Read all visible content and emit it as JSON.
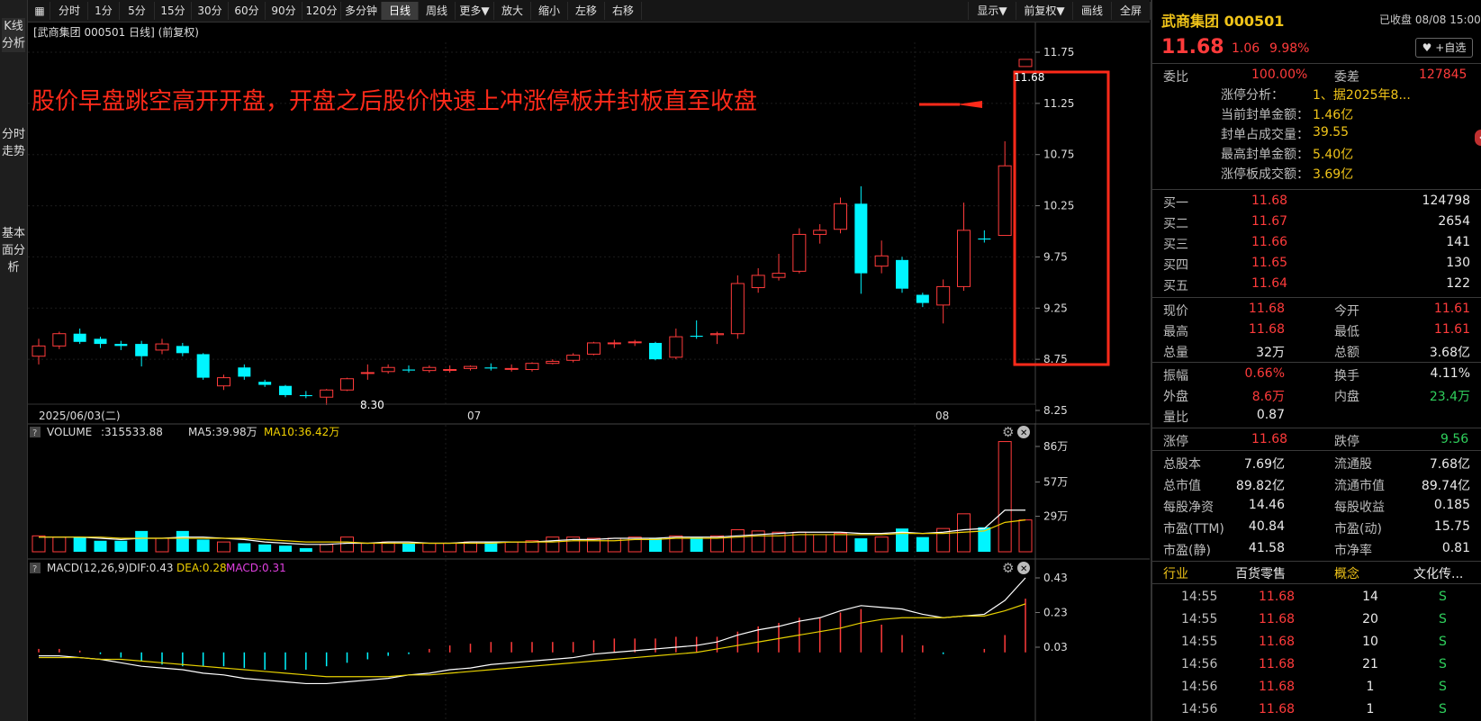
{
  "toolbar": {
    "items": [
      "分时",
      "1分",
      "5分",
      "15分",
      "30分",
      "60分",
      "90分",
      "120分",
      "多分钟",
      "日线",
      "周线",
      "更多▼",
      "放大",
      "缩小",
      "左移",
      "右移"
    ],
    "right_items": [
      "显示▼",
      "前复权▼",
      "画线",
      "全屏"
    ]
  },
  "left_tabs": [
    "K线分析",
    "分时走势",
    "基本面分析"
  ],
  "chart": {
    "header": "[武商集团 000501 日线] (前复权)",
    "annotation": "股价早盘跳空高开开盘，开盘之后股价快速上冲涨停板并封板直至收盘",
    "price_label": "11.68",
    "low_label": "8.30",
    "date_start": "2025/06/03(二)",
    "month_07": "07",
    "month_08": "08",
    "volume_header": ":315533.88",
    "volume_label": "VOLUME",
    "ma5": "MA5:39.98万",
    "ma10": "MA10:36.42万",
    "macd_label": "MACD(12,26,9)",
    "dif": "DIF:0.43",
    "dea": "DEA:0.28",
    "macd": "MACD:0.31"
  },
  "chart_data": {
    "type": "candlestick",
    "price_axis": [
      "11.75",
      "11.25",
      "10.75",
      "10.25",
      "9.75",
      "9.25",
      "8.75",
      "8.25"
    ],
    "volume_axis": [
      "86万",
      "57万",
      "29万"
    ],
    "macd_axis": [
      "0.43",
      "0.23",
      "0.03"
    ],
    "candles": [
      {
        "o": 8.78,
        "c": 8.88,
        "h": 8.95,
        "l": 8.7
      },
      {
        "o": 8.88,
        "c": 9.0,
        "h": 9.02,
        "l": 8.85
      },
      {
        "o": 9.0,
        "c": 8.92,
        "h": 9.05,
        "l": 8.9
      },
      {
        "o": 8.95,
        "c": 8.9,
        "h": 8.97,
        "l": 8.86
      },
      {
        "o": 8.9,
        "c": 8.88,
        "h": 8.93,
        "l": 8.84
      },
      {
        "o": 8.9,
        "c": 8.78,
        "h": 8.93,
        "l": 8.68
      },
      {
        "o": 8.84,
        "c": 8.9,
        "h": 8.95,
        "l": 8.8
      },
      {
        "o": 8.88,
        "c": 8.81,
        "h": 8.91,
        "l": 8.78
      },
      {
        "o": 8.8,
        "c": 8.57,
        "h": 8.81,
        "l": 8.55
      },
      {
        "o": 8.49,
        "c": 8.57,
        "h": 8.6,
        "l": 8.45
      },
      {
        "o": 8.67,
        "c": 8.58,
        "h": 8.7,
        "l": 8.55
      },
      {
        "o": 8.53,
        "c": 8.5,
        "h": 8.55,
        "l": 8.48
      },
      {
        "o": 8.49,
        "c": 8.4,
        "h": 8.5,
        "l": 8.38
      },
      {
        "o": 8.4,
        "c": 8.39,
        "h": 8.44,
        "l": 8.37
      },
      {
        "o": 8.38,
        "c": 8.45,
        "h": 8.46,
        "l": 8.3
      },
      {
        "o": 8.45,
        "c": 8.56,
        "h": 8.57,
        "l": 8.44
      },
      {
        "o": 8.62,
        "c": 8.62,
        "h": 8.7,
        "l": 8.55
      },
      {
        "o": 8.63,
        "c": 8.67,
        "h": 8.7,
        "l": 8.61
      },
      {
        "o": 8.65,
        "c": 8.64,
        "h": 8.69,
        "l": 8.62
      },
      {
        "o": 8.64,
        "c": 8.67,
        "h": 8.69,
        "l": 8.62
      },
      {
        "o": 8.65,
        "c": 8.65,
        "h": 8.69,
        "l": 8.62
      },
      {
        "o": 8.66,
        "c": 8.68,
        "h": 8.69,
        "l": 8.64
      },
      {
        "o": 8.67,
        "c": 8.66,
        "h": 8.71,
        "l": 8.64
      },
      {
        "o": 8.66,
        "c": 8.66,
        "h": 8.7,
        "l": 8.63
      },
      {
        "o": 8.65,
        "c": 8.71,
        "h": 8.72,
        "l": 8.63
      },
      {
        "o": 8.71,
        "c": 8.73,
        "h": 8.75,
        "l": 8.7
      },
      {
        "o": 8.74,
        "c": 8.79,
        "h": 8.81,
        "l": 8.72
      },
      {
        "o": 8.8,
        "c": 8.91,
        "h": 8.92,
        "l": 8.79
      },
      {
        "o": 8.91,
        "c": 8.91,
        "h": 8.94,
        "l": 8.86
      },
      {
        "o": 8.92,
        "c": 8.92,
        "h": 8.94,
        "l": 8.88
      },
      {
        "o": 8.91,
        "c": 8.75,
        "h": 8.92,
        "l": 8.74
      },
      {
        "o": 8.77,
        "c": 8.97,
        "h": 9.05,
        "l": 8.75
      },
      {
        "o": 8.98,
        "c": 8.97,
        "h": 9.13,
        "l": 8.95
      },
      {
        "o": 8.99,
        "c": 9.0,
        "h": 9.02,
        "l": 8.9
      },
      {
        "o": 9.0,
        "c": 9.49,
        "h": 9.57,
        "l": 8.95
      },
      {
        "o": 9.45,
        "c": 9.57,
        "h": 9.64,
        "l": 9.4
      },
      {
        "o": 9.55,
        "c": 9.59,
        "h": 9.78,
        "l": 9.52
      },
      {
        "o": 9.61,
        "c": 9.97,
        "h": 10.03,
        "l": 9.59
      },
      {
        "o": 9.97,
        "c": 10.01,
        "h": 10.07,
        "l": 9.88
      },
      {
        "o": 10.02,
        "c": 10.27,
        "h": 10.33,
        "l": 9.98
      },
      {
        "o": 10.27,
        "c": 9.59,
        "h": 10.44,
        "l": 9.39
      },
      {
        "o": 9.66,
        "c": 9.76,
        "h": 9.91,
        "l": 9.59
      },
      {
        "o": 9.72,
        "c": 9.44,
        "h": 9.75,
        "l": 9.4
      },
      {
        "o": 9.38,
        "c": 9.3,
        "h": 9.4,
        "l": 9.26
      },
      {
        "o": 9.28,
        "c": 9.46,
        "h": 9.53,
        "l": 9.1
      },
      {
        "o": 9.46,
        "c": 10.01,
        "h": 10.28,
        "l": 9.42
      },
      {
        "o": 9.93,
        "c": 9.92,
        "h": 10.01,
        "l": 9.89
      },
      {
        "o": 9.96,
        "c": 10.64,
        "h": 10.88,
        "l": 9.96
      },
      {
        "o": 11.61,
        "c": 11.68,
        "h": 11.68,
        "l": 11.61
      }
    ],
    "volumes": [
      13,
      12,
      12,
      9,
      9,
      17,
      11,
      17,
      10,
      8,
      7,
      6,
      5,
      3,
      6,
      12,
      7,
      8,
      7,
      7,
      7,
      8,
      8,
      8,
      9,
      12,
      12,
      11,
      11,
      12,
      11,
      13,
      12,
      13,
      18,
      17,
      16,
      16,
      14,
      15,
      11,
      12,
      19,
      12,
      19,
      31,
      20,
      90,
      26
    ],
    "vol_ma5": [
      12,
      12,
      12,
      11,
      10,
      11,
      11,
      12,
      12,
      11,
      10,
      8,
      7,
      6,
      6,
      7,
      7,
      8,
      8,
      7,
      7,
      8,
      8,
      8,
      8,
      9,
      10,
      10,
      11,
      11,
      11,
      12,
      12,
      12,
      13,
      14,
      15,
      16,
      16,
      16,
      15,
      15,
      16,
      15,
      16,
      18,
      19,
      34,
      34
    ],
    "vol_ma10": [
      12,
      12,
      12,
      12,
      11,
      11,
      11,
      11,
      11,
      11,
      11,
      10,
      9,
      8,
      8,
      8,
      7,
      7,
      7,
      7,
      7,
      7,
      7,
      8,
      8,
      8,
      9,
      9,
      9,
      10,
      10,
      11,
      11,
      11,
      12,
      13,
      13,
      14,
      14,
      14,
      14,
      14,
      15,
      15,
      15,
      16,
      17,
      24,
      26
    ],
    "dif": [
      -0.02,
      -0.02,
      -0.03,
      -0.04,
      -0.06,
      -0.08,
      -0.09,
      -0.1,
      -0.12,
      -0.13,
      -0.15,
      -0.16,
      -0.17,
      -0.18,
      -0.18,
      -0.17,
      -0.16,
      -0.15,
      -0.13,
      -0.12,
      -0.1,
      -0.09,
      -0.07,
      -0.06,
      -0.05,
      -0.04,
      -0.03,
      -0.01,
      0.0,
      0.01,
      0.02,
      0.03,
      0.04,
      0.06,
      0.1,
      0.13,
      0.15,
      0.18,
      0.2,
      0.24,
      0.27,
      0.26,
      0.25,
      0.22,
      0.2,
      0.21,
      0.22,
      0.3,
      0.43
    ],
    "dea": [
      -0.03,
      -0.03,
      -0.03,
      -0.04,
      -0.04,
      -0.05,
      -0.06,
      -0.07,
      -0.08,
      -0.09,
      -0.1,
      -0.11,
      -0.12,
      -0.13,
      -0.14,
      -0.14,
      -0.14,
      -0.14,
      -0.13,
      -0.13,
      -0.12,
      -0.11,
      -0.1,
      -0.09,
      -0.08,
      -0.07,
      -0.06,
      -0.05,
      -0.04,
      -0.03,
      -0.02,
      -0.01,
      0.0,
      0.02,
      0.04,
      0.06,
      0.08,
      0.1,
      0.12,
      0.14,
      0.17,
      0.19,
      0.2,
      0.2,
      0.2,
      0.21,
      0.21,
      0.24,
      0.28
    ],
    "macd_bars": [
      0.02,
      0.02,
      0.01,
      -0.01,
      -0.03,
      -0.05,
      -0.07,
      -0.08,
      -0.08,
      -0.08,
      -0.09,
      -0.1,
      -0.1,
      -0.1,
      -0.08,
      -0.06,
      -0.04,
      -0.02,
      -0.01,
      0.02,
      0.04,
      0.05,
      0.06,
      0.06,
      0.06,
      0.06,
      0.06,
      0.07,
      0.08,
      0.08,
      0.08,
      0.09,
      0.09,
      0.09,
      0.12,
      0.15,
      0.17,
      0.2,
      0.2,
      0.23,
      0.25,
      0.16,
      0.1,
      0.04,
      -0.01,
      0.0,
      0.02,
      0.1,
      0.31
    ]
  },
  "stock": {
    "name": "武商集团 000501",
    "status": "已收盘 08/08 15:00",
    "price": "11.68",
    "change": "1.06",
    "pct": "9.98%",
    "watch": "+自选"
  },
  "weibi": {
    "l1": "委比",
    "v1": "100.00%",
    "l2": "委差",
    "v2": "127845"
  },
  "limit": [
    {
      "l": "涨停分析：",
      "v": "1、据2025年8..."
    },
    {
      "l": "当前封单金额：",
      "v": "1.46亿"
    },
    {
      "l": "封单占成交量：",
      "v": "39.55"
    },
    {
      "l": "最高封单金额：",
      "v": "5.40亿"
    },
    {
      "l": "涨停板成交额：",
      "v": "3.69亿"
    }
  ],
  "bids": [
    {
      "l": "买一",
      "p": "11.68",
      "q": "124798"
    },
    {
      "l": "买二",
      "p": "11.67",
      "q": "2654"
    },
    {
      "l": "买三",
      "p": "11.66",
      "q": "141"
    },
    {
      "l": "买四",
      "p": "11.65",
      "q": "130"
    },
    {
      "l": "买五",
      "p": "11.64",
      "q": "122"
    }
  ],
  "quote1": [
    {
      "l1": "现价",
      "v1": "11.68",
      "l2": "今开",
      "v2": "11.61"
    },
    {
      "l1": "最高",
      "v1": "11.68",
      "l2": "最低",
      "v2": "11.61"
    },
    {
      "l1": "总量",
      "v1": "32万",
      "l2": "总额",
      "v2": "3.68亿"
    }
  ],
  "quote2": [
    {
      "l1": "振幅",
      "v1": "0.66%",
      "l2": "换手",
      "v2": "4.11%"
    },
    {
      "l1": "外盘",
      "v1": "8.6万",
      "l2": "内盘",
      "v2": "23.4万"
    },
    {
      "l1": "量比",
      "v1": "0.87",
      "l2": "",
      "v2": ""
    }
  ],
  "limitline": {
    "l1": "涨停",
    "v1": "11.68",
    "l2": "跌停",
    "v2": "9.56"
  },
  "fund": [
    {
      "l1": "总股本",
      "v1": "7.69亿",
      "l2": "流通股",
      "v2": "7.68亿"
    },
    {
      "l1": "总市值",
      "v1": "89.82亿",
      "l2": "流通市值",
      "v2": "89.74亿"
    },
    {
      "l1": "每股净资",
      "v1": "14.46",
      "l2": "每股收益",
      "v2": "0.185"
    },
    {
      "l1": "市盈(TTM)",
      "v1": "40.84",
      "l2": "市盈(动)",
      "v2": "15.75"
    },
    {
      "l1": "市盈(静)",
      "v1": "41.58",
      "l2": "市净率",
      "v2": "0.81"
    }
  ],
  "industry": {
    "l1": "行业",
    "v1": "百货零售",
    "l2": "概念",
    "v2": "文化传..."
  },
  "ticks": [
    {
      "t": "14:55",
      "p": "11.68",
      "q": "14",
      "s": "S"
    },
    {
      "t": "14:55",
      "p": "11.68",
      "q": "20",
      "s": "S"
    },
    {
      "t": "14:55",
      "p": "11.68",
      "q": "10",
      "s": "S"
    },
    {
      "t": "14:56",
      "p": "11.68",
      "q": "21",
      "s": "S"
    },
    {
      "t": "14:56",
      "p": "11.68",
      "q": "1",
      "s": "S"
    },
    {
      "t": "14:56",
      "p": "11.68",
      "q": "1",
      "s": "S"
    }
  ],
  "colors": {
    "up": "#ff3b3b",
    "down": "#00f5ff",
    "ma5": "#ffffff",
    "ma10": "#f0d000",
    "dea": "#e6d000",
    "annotation": "#ff2a1a"
  }
}
